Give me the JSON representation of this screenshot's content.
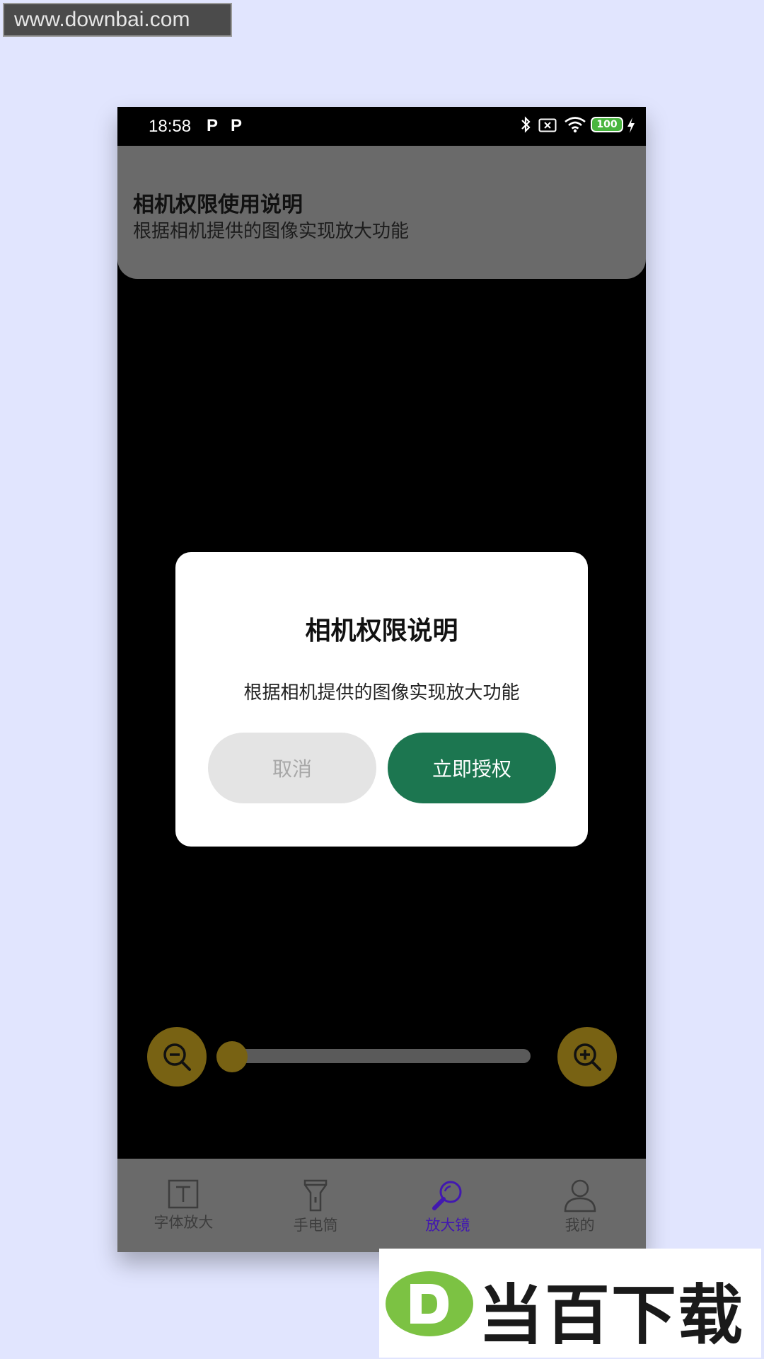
{
  "watermark": {
    "url": "www.downbai.com",
    "brand": "当百下载"
  },
  "status_bar": {
    "time": "18:58",
    "battery": "100"
  },
  "notice": {
    "title": "相机权限使用说明",
    "description": "根据相机提供的图像实现放大功能"
  },
  "dialog": {
    "title": "相机权限说明",
    "description": "根据相机提供的图像实现放大功能",
    "cancel_label": "取消",
    "confirm_label": "立即授权"
  },
  "zoom": {
    "level": 0
  },
  "nav": {
    "items": [
      {
        "label": "字体放大",
        "icon": "text-icon"
      },
      {
        "label": "手电筒",
        "icon": "flashlight-icon"
      },
      {
        "label": "放大镜",
        "icon": "magnifier-icon",
        "active": true
      },
      {
        "label": "我的",
        "icon": "person-icon"
      }
    ]
  },
  "colors": {
    "background": "#e1e5fe",
    "accent_green": "#1c7650",
    "nav_active": "#4218b0",
    "zoom_gold": "#786213"
  }
}
